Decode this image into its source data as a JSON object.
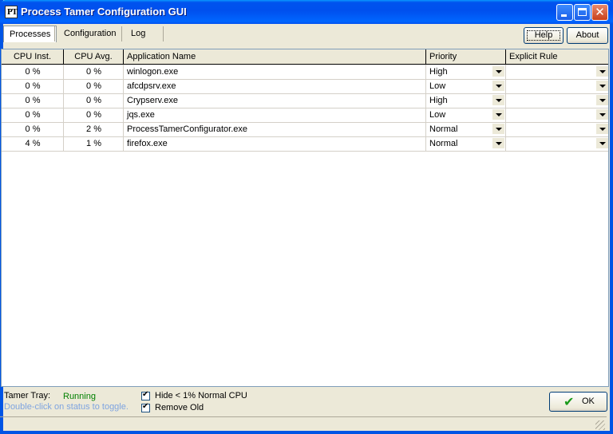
{
  "window": {
    "title": "Process Tamer Configuration GUI",
    "icon": "process-tamer-icon",
    "icon_letters": "PT"
  },
  "tabs": [
    {
      "label": "Processes",
      "active": true
    },
    {
      "label": "Configuration",
      "active": false
    },
    {
      "label": "Log",
      "active": false
    }
  ],
  "buttons": {
    "help": "Help",
    "about": "About",
    "ok": "OK"
  },
  "table": {
    "columns": [
      "CPU Inst.",
      "CPU Avg.",
      "Application Name",
      "Priority",
      "Explicit Rule"
    ],
    "rows": [
      {
        "cpu_inst": "0 %",
        "cpu_avg": "0 %",
        "app": "winlogon.exe",
        "priority": "High",
        "rule": ""
      },
      {
        "cpu_inst": "0 %",
        "cpu_avg": "0 %",
        "app": "afcdpsrv.exe",
        "priority": "Low",
        "rule": ""
      },
      {
        "cpu_inst": "0 %",
        "cpu_avg": "0 %",
        "app": "Crypserv.exe",
        "priority": "High",
        "rule": ""
      },
      {
        "cpu_inst": "0 %",
        "cpu_avg": "0 %",
        "app": "jqs.exe",
        "priority": "Low",
        "rule": ""
      },
      {
        "cpu_inst": "0 %",
        "cpu_avg": "2 %",
        "app": "ProcessTamerConfigurator.exe",
        "priority": "Normal",
        "rule": ""
      },
      {
        "cpu_inst": "4 %",
        "cpu_avg": "1 %",
        "app": "firefox.exe",
        "priority": "Normal",
        "rule": ""
      }
    ]
  },
  "status": {
    "tray_label": "Tamer Tray:",
    "tray_value": "Running",
    "tray_hint": "Double-click on status to toggle.",
    "hide_label": "Hide < 1% Normal CPU",
    "hide_checked": true,
    "remove_label": "Remove Old",
    "remove_checked": true
  },
  "colors": {
    "titlebar": "#0053ee",
    "running": "#008000",
    "hint": "#7ea4e0"
  }
}
